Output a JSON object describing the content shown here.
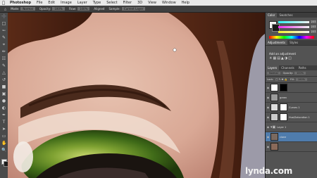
{
  "menubar": {
    "items": [
      {
        "label": "Photoshop",
        "bold": true
      },
      {
        "label": "File"
      },
      {
        "label": "Edit"
      },
      {
        "label": "Image"
      },
      {
        "label": "Layer"
      },
      {
        "label": "Type"
      },
      {
        "label": "Select"
      },
      {
        "label": "Filter"
      },
      {
        "label": "3D"
      },
      {
        "label": "View"
      },
      {
        "label": "Window"
      },
      {
        "label": "Help"
      }
    ]
  },
  "options": {
    "mode_label": "Mode:",
    "mode_value": "Normal",
    "opacity_label": "Opacity:",
    "opacity_value": "100%",
    "flow_label": "Flow:",
    "flow_value": "100%",
    "aligned_label": "Aligned",
    "sample_label": "Sample:",
    "sample_value": "Current Layer"
  },
  "panels": {
    "color_tabs": [
      "Color",
      "Swatches"
    ],
    "slider_values": [
      "237",
      "237",
      "237"
    ],
    "adjust_tabs": [
      "Adjustments",
      "Styles"
    ],
    "adjust_title": "Add an adjustment",
    "layer_tabs": [
      "Layers",
      "Channels",
      "Paths"
    ],
    "blend_mode": "Normal",
    "opacity_label": "Opacity:",
    "opacity_value": "100%",
    "lock_label": "Lock:",
    "fill_label": "Fill:",
    "fill_value": "100%",
    "layers": [
      {
        "name": "",
        "selected": false
      },
      {
        "name": "green",
        "selected": false
      },
      {
        "name": "Curves 1",
        "selected": false
      },
      {
        "name": "Hue/Saturation 1",
        "selected": false
      },
      {
        "name": "Layer 1",
        "selected": false
      },
      {
        "name": "clone",
        "selected": true
      },
      {
        "name": "",
        "selected": false
      }
    ]
  },
  "watermark": {
    "text": "lynda",
    "suffix": ".com"
  },
  "colors": {
    "accent": "#4f7cac",
    "fg": "#f2f2f2",
    "bg": "#1a1a1a"
  }
}
